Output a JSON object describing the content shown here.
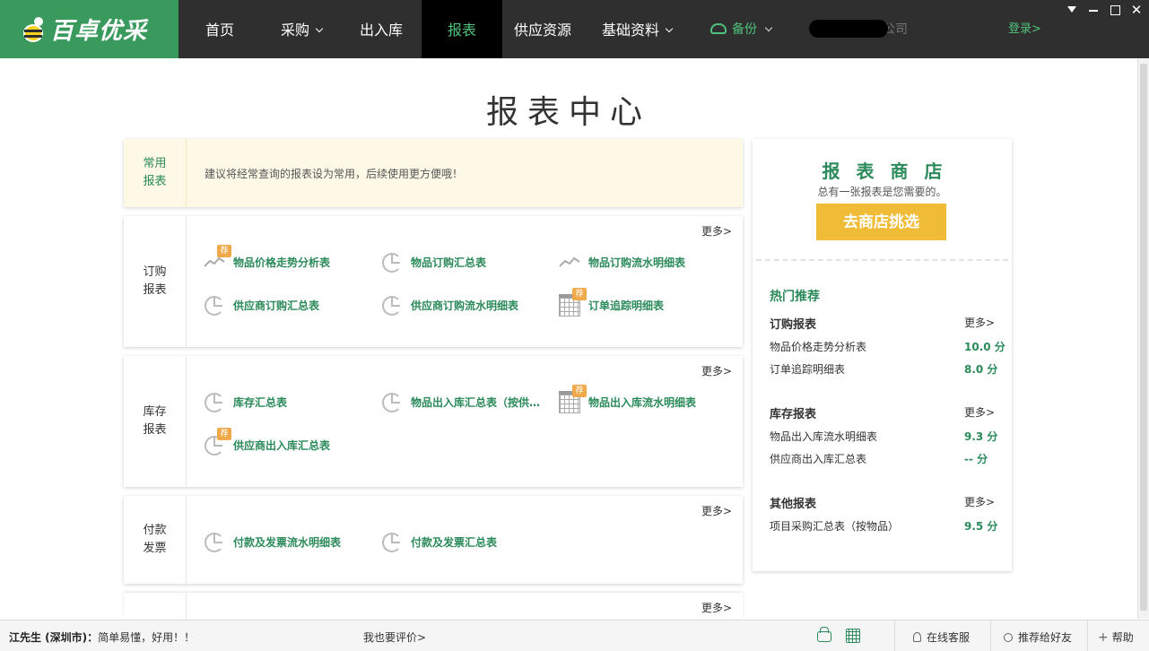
{
  "app": {
    "logo_text": "百卓优采",
    "nav": [
      {
        "label": "首页",
        "has_menu": false
      },
      {
        "label": "采购",
        "has_menu": true
      },
      {
        "label": "出入库",
        "has_menu": false
      },
      {
        "label": "报表",
        "has_menu": false,
        "active": true
      },
      {
        "label": "供应资源",
        "has_menu": false
      },
      {
        "label": "基础资料",
        "has_menu": true
      }
    ],
    "backup_label": "备份",
    "company_suffix": "公司",
    "login_label": "登录>"
  },
  "page": {
    "title": "报表中心"
  },
  "favorite": {
    "category": "常用报表",
    "tip": "建议将经常查询的报表设为常用，后续使用更方便哦！"
  },
  "sections": [
    {
      "category": "订购报表",
      "more": "更多>",
      "reports": [
        {
          "label": "物品价格走势分析表",
          "icon": "line-chart-icon",
          "recommended": true
        },
        {
          "label": "物品订购汇总表",
          "icon": "pie-chart-icon",
          "recommended": false
        },
        {
          "label": "物品订购流水明细表",
          "icon": "line-chart-icon",
          "recommended": false
        },
        {
          "label": "供应商订购汇总表",
          "icon": "pie-chart-icon",
          "recommended": false
        },
        {
          "label": "供应商订购流水明细表",
          "icon": "pie-chart-icon",
          "recommended": false
        },
        {
          "label": "订单追踪明细表",
          "icon": "grid-table-icon",
          "recommended": true
        }
      ]
    },
    {
      "category": "库存报表",
      "more": "更多>",
      "reports": [
        {
          "label": "库存汇总表",
          "icon": "pie-chart-icon",
          "recommended": false
        },
        {
          "label": "物品出入库汇总表（按供…",
          "icon": "pie-chart-icon",
          "recommended": false
        },
        {
          "label": "物品出入库流水明细表",
          "icon": "grid-table-icon",
          "recommended": true
        },
        {
          "label": "供应商出入库汇总表",
          "icon": "pie-chart-icon",
          "recommended": true
        }
      ]
    },
    {
      "category": "付款发票",
      "more": "更多>",
      "reports": [
        {
          "label": "付款及发票流水明细表",
          "icon": "pie-chart-icon",
          "recommended": false
        },
        {
          "label": "付款及发票汇总表",
          "icon": "pie-chart-icon",
          "recommended": false
        }
      ]
    },
    {
      "category": "",
      "more": "更多>",
      "reports": []
    }
  ],
  "badge_label": "荐",
  "store": {
    "title": "报表商店",
    "subtitle": "总有一张报表是您需要的。",
    "button": "去商店挑选",
    "hot_title": "热门推荐",
    "groups": [
      {
        "title": "订购报表",
        "more": "更多>",
        "items": [
          {
            "label": "物品价格走势分析表",
            "score": "10.0 分"
          },
          {
            "label": "订单追踪明细表",
            "score": "8.0 分"
          }
        ]
      },
      {
        "title": "库存报表",
        "more": "更多>",
        "items": [
          {
            "label": "物品出入库流水明细表",
            "score": "9.3 分"
          },
          {
            "label": "供应商出入库汇总表",
            "score": "-- 分"
          }
        ]
      },
      {
        "title": "其他报表",
        "more": "更多>",
        "items": [
          {
            "label": "项目采购汇总表（按物品）",
            "score": "9.5 分"
          }
        ]
      }
    ]
  },
  "footer": {
    "comment_user": "江先生 (深圳市)：",
    "comment_text": "简单易懂，好用！！",
    "rate_link": "我也要评价>",
    "online_service": "在线客服",
    "recommend_friend": "推荐给好友",
    "help": "帮助"
  },
  "colors": {
    "brand_green": "#3a9a5e",
    "link_green": "#2b8a5a",
    "topbar": "#2f2f2f",
    "store_button": "#f0bb36",
    "badge": "#f0a94a"
  }
}
